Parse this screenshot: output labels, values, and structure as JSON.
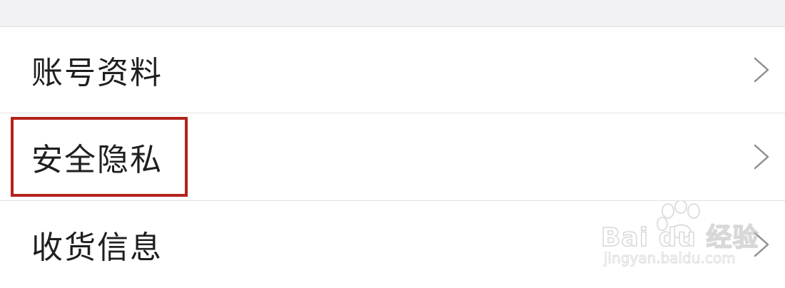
{
  "settings": {
    "items": [
      {
        "label": "账号资料",
        "icon": "chevron-right-icon"
      },
      {
        "label": "安全隐私",
        "icon": "chevron-right-icon"
      },
      {
        "label": "收货信息",
        "icon": "chevron-right-icon"
      }
    ],
    "highlighted_item": "安全隐私"
  },
  "watermark": {
    "brand": "Bai du 经验",
    "url": "jingyan.baidu.com"
  },
  "colors": {
    "top_background": "#f2f2f4",
    "row_background": "#ffffff",
    "divider": "#e1e1e3",
    "label_text": "#1f1f1f",
    "chevron": "#8e8e93",
    "highlight_border": "#b3221b"
  }
}
